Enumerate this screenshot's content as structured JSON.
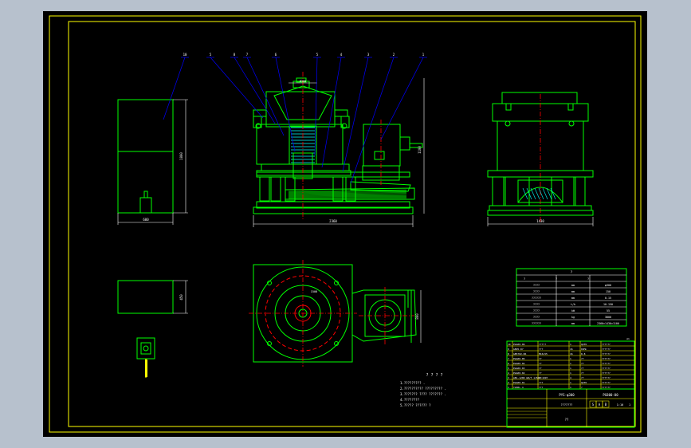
{
  "colors": {
    "background": "#000000",
    "window_frame": "#b7c1cd",
    "border": "#ffff00",
    "part": "#00ff00",
    "leader": "#0000ff",
    "centerline": "#ff0000",
    "dimension": "#ffffff",
    "hatch": "#00ffff"
  },
  "balloons": [
    "10",
    "5",
    "8",
    "7",
    "6",
    "5",
    "4",
    "3",
    "2",
    "1"
  ],
  "dimensions": {
    "top_width": "Ø300",
    "height_front": "1100",
    "base_length": "2360",
    "side_width": "1430",
    "box_width": "600",
    "box_height": "1000",
    "box_plan": "450",
    "plan_side": "800",
    "plan_len": "1500"
  },
  "spec_table": {
    "header": [
      "?",
      "?",
      "?",
      "?"
    ],
    "rows": [
      [
        "????",
        "mm",
        "φ300"
      ],
      [
        "????",
        "mm",
        "150"
      ],
      [
        "??????",
        "mm",
        "0-15"
      ],
      [
        "????",
        "t/h",
        "10-150"
      ],
      [
        "????",
        "kW",
        "55"
      ],
      [
        "????",
        "kg",
        "3800"
      ],
      [
        "??????",
        "mm",
        "2360×1430×1100"
      ]
    ]
  },
  "bom": {
    "rows": [
      [
        "10",
        "PGA00-06",
        "?????",
        "1",
        "Q235",
        "??????"
      ],
      [
        "9",
        "GB95-87",
        "???",
        "16",
        "65Mn",
        "??????"
      ],
      [
        "8",
        "GB5782-86",
        "M16×55",
        "16",
        "8.8",
        "??????"
      ],
      [
        "7",
        "PGA00-05",
        "??",
        "1",
        "??",
        "??????"
      ],
      [
        "6",
        "PGA00-04",
        "??",
        "1",
        "??",
        "??????"
      ],
      [
        "5",
        "PGA00-03",
        "??",
        "1",
        "??",
        "??????"
      ],
      [
        "4",
        "PGA00-02",
        "??",
        "1",
        "??",
        "??????"
      ],
      [
        "3",
        "AB1-1200 GB/T 11544-1997",
        "??",
        "4",
        "??",
        "??????"
      ],
      [
        "2",
        "PGA00-01",
        "???",
        "1",
        "Q235",
        "??????"
      ],
      [
        "1",
        "Y200L-4",
        "???",
        "1",
        "?",
        "??????"
      ]
    ],
    "mark": "A1"
  },
  "title_block": {
    "product": "PYS-φ300",
    "drawing_no": "PG800-00",
    "subtitle": "???????",
    "scale_labels": [
      "S",
      "A",
      "B"
    ],
    "scale": "1:10",
    "sheet": "1",
    "footer": "??"
  },
  "notes": {
    "heading": "? ? ? ?",
    "lines": [
      "1.????????? .",
      "2.?????????? ????????? .",
      "3.??????? ???? ??????? .",
      "4.????????",
      "5.????? ??????  ?"
    ]
  }
}
